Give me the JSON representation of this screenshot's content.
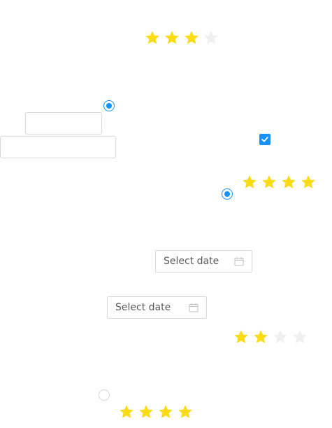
{
  "ratings": [
    {
      "value": 3,
      "max": 4
    },
    {
      "value": 4,
      "max": 4
    },
    {
      "value": 2,
      "max": 4
    },
    {
      "value": 4,
      "max": 4
    }
  ],
  "radios": [
    {
      "checked": true
    },
    {
      "checked": true
    },
    {
      "checked": false
    }
  ],
  "checkbox": {
    "checked": true
  },
  "inputs": [
    {
      "value": "",
      "placeholder": ""
    },
    {
      "value": "",
      "placeholder": ""
    }
  ],
  "date_pickers": [
    {
      "placeholder": "Select date",
      "icon": "calendar-icon"
    },
    {
      "placeholder": "Select date",
      "icon": "calendar-icon"
    }
  ],
  "colors": {
    "star_filled": "#fadb14",
    "star_empty": "#f0f0f0",
    "accent": "#1890ff",
    "border": "#d9d9d9"
  }
}
